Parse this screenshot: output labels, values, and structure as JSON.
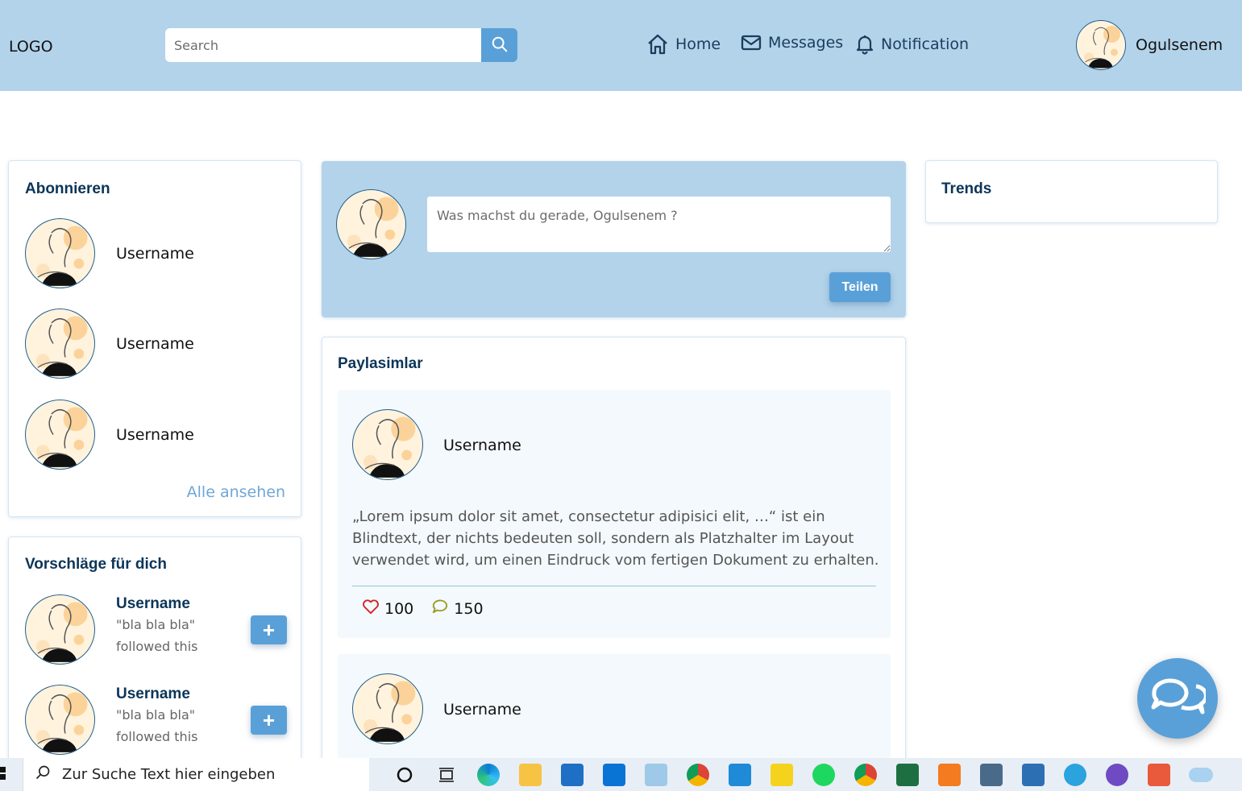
{
  "header": {
    "logo": "LOGO",
    "search_placeholder": "Search",
    "nav": {
      "home": "Home",
      "messages": "Messages",
      "notification": "Notification"
    },
    "profile_name": "Ogulsenem"
  },
  "subscriptions": {
    "title": "Abonnieren",
    "items": [
      {
        "username": "Username"
      },
      {
        "username": "Username"
      },
      {
        "username": "Username"
      }
    ],
    "see_all": "Alle ansehen"
  },
  "suggestions": {
    "title": "Vorschläge für dich",
    "items": [
      {
        "username": "Username",
        "quote": "\"bla bla bla\"",
        "subtitle": "followed this",
        "button": "+"
      },
      {
        "username": "Username",
        "quote": "\"bla bla bla\"",
        "subtitle": "followed this",
        "button": "+"
      }
    ]
  },
  "composer": {
    "placeholder": "Was machst du gerade, Ogulsenem ?",
    "share_label": "Teilen"
  },
  "posts": {
    "title": "Paylasimlar",
    "items": [
      {
        "username": "Username",
        "text": "„Lorem ipsum dolor sit amet, consectetur adipisici elit, …“ ist ein Blindtext, der nichts bedeuten soll, sondern als Platzhalter im Layout verwendet wird, um einen Eindruck vom fertigen Dokument zu erhalten.",
        "likes": "100",
        "comments": "150"
      },
      {
        "username": "Username"
      }
    ]
  },
  "trends": {
    "title": "Trends"
  },
  "taskbar": {
    "search_placeholder": "Zur Suche Text hier eingeben",
    "apps": [
      "cortana-icon",
      "task-view-icon",
      "edge-icon",
      "file-explorer-icon",
      "mail-icon",
      "outlook-icon",
      "notepad-icon",
      "chrome-icon",
      "vscode-icon",
      "player-icon",
      "spotify-icon",
      "chrome-profile-icon",
      "excel-icon",
      "xampp-icon",
      "network-icon",
      "photos-icon",
      "telegram-icon",
      "github-icon",
      "snipping-icon",
      "onedrive-icon"
    ]
  },
  "colors": {
    "header_bg": "#b3d3ea",
    "accent": "#5aa0d8",
    "title": "#0c3558",
    "link": "#6ea7d7"
  }
}
